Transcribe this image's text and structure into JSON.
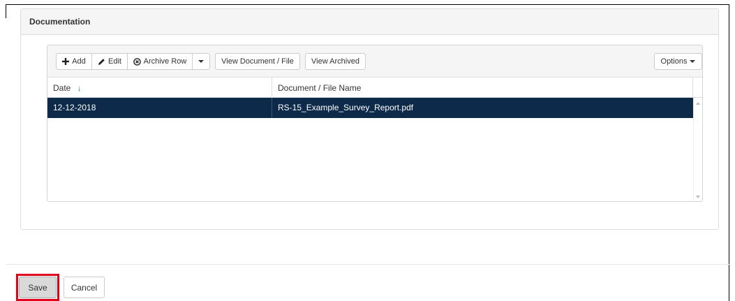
{
  "panel": {
    "title": "Documentation"
  },
  "toolbar": {
    "add_label": "Add",
    "edit_label": "Edit",
    "archive_row_label": "Archive Row",
    "view_document_label": "View Document / File",
    "view_archived_label": "View Archived",
    "options_label": "Options"
  },
  "table": {
    "columns": [
      {
        "label": "Date",
        "sort": "descending"
      },
      {
        "label": "Document / File Name"
      }
    ],
    "rows": [
      {
        "date": "12-12-2018",
        "document": "RS-15_Example_Survey_Report.pdf",
        "selected": true
      }
    ]
  },
  "footer": {
    "save_label": "Save",
    "cancel_label": "Cancel"
  },
  "icons": {
    "add": "plus-icon",
    "edit": "pencil-icon",
    "archive": "circle-x-icon",
    "sort": "arrow-down-icon",
    "dropdown": "caret-down-icon"
  },
  "colors": {
    "selected_row": "#0e2a4a",
    "sort_arrow": "#337ab7",
    "save_highlight": "#e3001b"
  }
}
